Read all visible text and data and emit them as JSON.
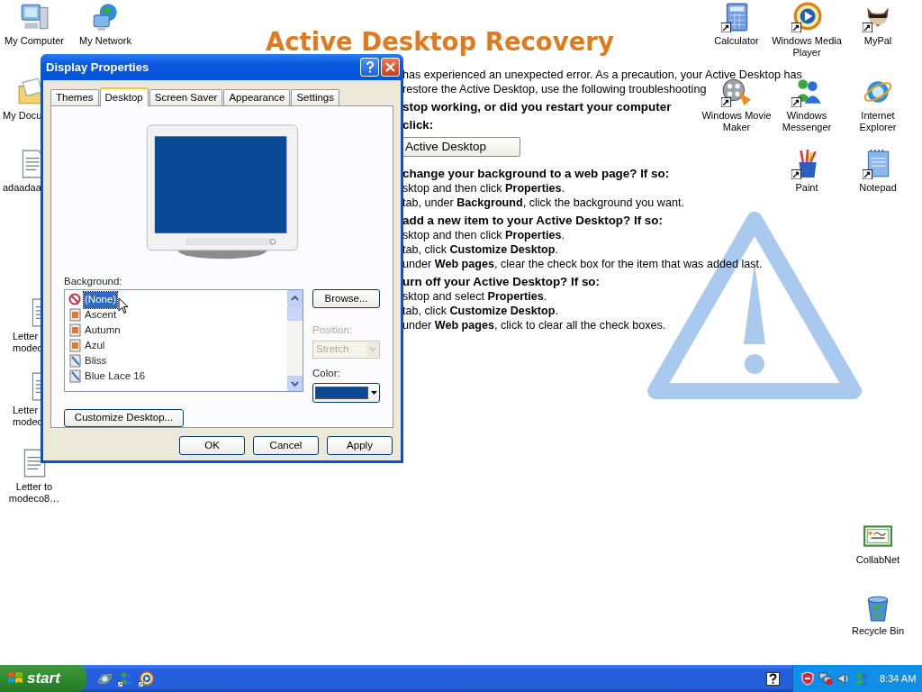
{
  "page": {
    "title": "Active Desktop Recovery",
    "blocks": [
      {
        "kind": "text",
        "text": "has experienced an unexpected error. As a precaution, your Active Desktop has"
      },
      {
        "kind": "text",
        "text": "restore the Active Desktop, use the following troubleshooting"
      },
      {
        "kind": "heading",
        "text": "stop working, or did you restart your computer"
      },
      {
        "kind": "heading",
        "text": "click:"
      },
      {
        "kind": "button",
        "text": "Active Desktop"
      },
      {
        "kind": "heading",
        "text": "change your background to a web page? If so:"
      },
      {
        "kind": "text",
        "text": "sktop and then click **Properties**."
      },
      {
        "kind": "text",
        "text": "tab, under **Background**, click the background you want."
      },
      {
        "kind": "heading",
        "text": "add a new item to your Active Desktop? If so:"
      },
      {
        "kind": "text",
        "text": "sktop and then click **Properties**."
      },
      {
        "kind": "text",
        "text": "tab, click **Customize Desktop**."
      },
      {
        "kind": "text",
        "text": "under **Web pages**, clear the check box for the item that was added last."
      },
      {
        "kind": "heading",
        "text": "urn off your Active Desktop? If so:"
      },
      {
        "kind": "text",
        "text": "sktop and select **Properties**."
      },
      {
        "kind": "text",
        "text": "tab, click **Customize Desktop**."
      },
      {
        "kind": "text",
        "text": "under **Web pages**, click to clear all the check boxes."
      }
    ]
  },
  "desktop_icons": [
    {
      "kind": "computer",
      "label": "My Computer"
    },
    {
      "kind": "network",
      "label": "My Network"
    },
    {
      "kind": "folder",
      "label": "My Docu"
    },
    {
      "kind": "document",
      "label": "adaadaa"
    },
    {
      "kind": "document",
      "label": "Letter modec"
    },
    {
      "kind": "document",
      "label": "Letter modec"
    },
    {
      "kind": "document",
      "label": "Letter to modeco8…"
    },
    {
      "kind": "calculator",
      "label": "Calculator"
    },
    {
      "kind": "media",
      "label": "Windows Media Player"
    },
    {
      "kind": "animal",
      "label": "MyPal"
    },
    {
      "kind": "movie",
      "label": "Windows Movie Maker"
    },
    {
      "kind": "messenger",
      "label": "Windows Messenger"
    },
    {
      "kind": "browser",
      "label": "Internet Explorer"
    },
    {
      "kind": "paint",
      "label": "Paint"
    },
    {
      "kind": "notepad",
      "label": "Notepad"
    },
    {
      "kind": "certificate",
      "label": "CollabNet"
    },
    {
      "kind": "recycle",
      "label": "Recycle Bin"
    }
  ],
  "dialog": {
    "title": "Display Properties",
    "tabs": [
      {
        "label": "Themes",
        "selected": false
      },
      {
        "label": "Desktop",
        "selected": true
      },
      {
        "label": "Screen Saver",
        "selected": false
      },
      {
        "label": "Appearance",
        "selected": false
      },
      {
        "label": "Settings",
        "selected": false
      }
    ],
    "background_label": "Background:",
    "backgrounds": [
      {
        "kind": "none",
        "label": "(None)",
        "selected": true
      },
      {
        "kind": "jpg",
        "label": "Ascent",
        "selected": false
      },
      {
        "kind": "jpg",
        "label": "Autumn",
        "selected": false
      },
      {
        "kind": "jpg",
        "label": "Azul",
        "selected": false
      },
      {
        "kind": "bmp",
        "label": "Bliss",
        "selected": false
      },
      {
        "kind": "bmp",
        "label": "Blue Lace 16",
        "selected": false
      }
    ],
    "browse_button": "Browse...",
    "position_label": "Position:",
    "position_value": "Stretch",
    "position_disabled": true,
    "color_label": "Color:",
    "color": "#0a4a96",
    "customize_button": "Customize Desktop...",
    "buttons": [
      "OK",
      "Cancel",
      "Apply"
    ]
  },
  "taskbar": {
    "start": "start",
    "clock": "8:34 AM"
  }
}
